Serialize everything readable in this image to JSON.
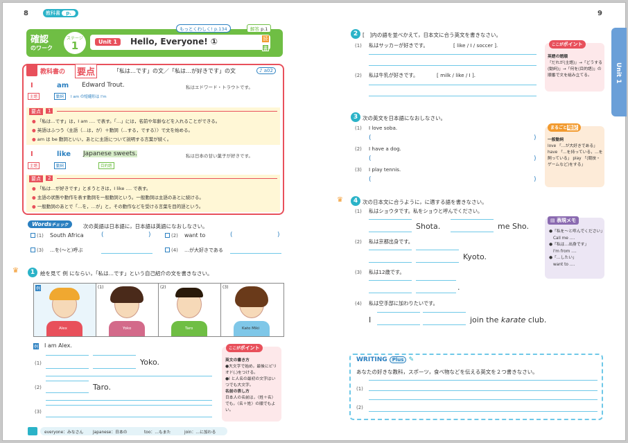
{
  "left_page": {
    "page_number": "8",
    "textbook_label": "教科書",
    "textbook_page": "p.",
    "header": {
      "kakunin": "確認",
      "no_work": "のワーク",
      "stage_label": "ステージ",
      "stage_num": "1",
      "unit_tag": "Unit 1",
      "unit_title": "Hello, Everyone! ①",
      "motto_label": "もっとくわしく!",
      "motto_page": "p.134",
      "answer_label": "解答",
      "answer_page": "p.1",
      "side_tabs": [
        "読",
        "書"
      ]
    },
    "point": {
      "title_a": "教科書の",
      "title_b": "要点",
      "subtitle": "「私は…です」の文／「私は…が好きです」の文",
      "audio": "a02",
      "ex1": {
        "w1": "I",
        "w2": "am",
        "w3": "Edward Trout.",
        "ja": "私はエドワード・トラウトです。",
        "tag1": "主語",
        "tag2": "動詞",
        "note": "I am の短縮形は I'm"
      },
      "p1": {
        "label": "要点",
        "num": "1",
        "lines": [
          "「私は…です」は，I am …. で表す。「…」には，名前や年齢などを入れることができる。",
          "英語はふつう〈主語（…は，が）＋動詞（…する，でする）〉で文を始める。",
          "am は be 動詞といい，あとに主語について説明する言葉が続く。"
        ]
      },
      "ex2": {
        "w1": "I",
        "w2": "like",
        "w3": "Japanese sweets.",
        "ja": "私は日本の甘い菓子が好きです。",
        "tag1": "主語",
        "tag2": "動詞",
        "tag3": "目的語"
      },
      "p2": {
        "label": "要点",
        "num": "2",
        "lines": [
          "「私は…が好きです」とまうときは，I like …. で表す。",
          "主語の状態や動作を表す動詞を一般動詞という。一般動詞は主語のあとに続ける。",
          "一般動詞のあとで「…を，…が」と，その動作などを受ける言葉を目的語という。"
        ]
      }
    },
    "words": {
      "logo": "Words",
      "logo2": "チェック",
      "instruction": "次の英語は日本語に，日本語は英語になおしなさい。",
      "items": [
        {
          "n": "(1)",
          "q": "South Africa",
          "a": "("
        },
        {
          "n": "(2)",
          "q": "want to",
          "a": "("
        },
        {
          "n": "(3)",
          "q": "…を(～と)呼ぶ",
          "a": ""
        },
        {
          "n": "(4)",
          "q": "…が大好きである",
          "a": ""
        }
      ]
    },
    "q1": {
      "num": "1",
      "instruction": "絵を見て 例 にならい，「私は…です」という自己紹介の文を書きなさい。",
      "pics": [
        {
          "tag": "例",
          "name": "Alex"
        },
        {
          "tag": "(1)",
          "name": "Yoko"
        },
        {
          "tag": "(2)",
          "name": "Taro"
        },
        {
          "tag": "(3)",
          "name": "Kato Miki"
        }
      ],
      "example": "I am Alex.",
      "a1_num": "(1)",
      "a1_word": "Yoko.",
      "a2_num": "(2)",
      "a2_word": "Taro.",
      "a3_num": "(3)"
    },
    "point_box": {
      "title_a": "ここが",
      "title_b": "ポイント",
      "h1": "英文の書き方",
      "l1": "●大文字で始め，最後にピリオド(.)をつける。",
      "l2": "●I と人名の最初の文字はいつでも大文字。",
      "h2": "名前の表し方",
      "l3": "日本人の名前は，〈姓＋名〉でも，〈名＋姓〉の順でもよい。"
    },
    "footer": [
      {
        "en": "everyone",
        "ja": "みなさん"
      },
      {
        "en": "Japanese",
        "ja": "日本の"
      },
      {
        "en": "too",
        "ja": "…もまた"
      },
      {
        "en": "join",
        "ja": "…に加わる"
      }
    ]
  },
  "right_page": {
    "page_number": "9",
    "unit_tab": "Unit 1",
    "q2": {
      "num": "2",
      "instruction": "[　]内の語を並べかえて，日本文に合う英文を書きなさい。",
      "i1": {
        "n": "(1)",
        "ja": "私はサッカーが好きです。",
        "words": "[ like / I / soccer ]."
      },
      "i2": {
        "n": "(2)",
        "ja": "私は牛乳が好きです。",
        "words": "[ milk / like / I ]."
      }
    },
    "kokoga": {
      "title_a": "ここが",
      "title_b": "ポイント",
      "head": "英語の語順",
      "body": "「だれが(主語)」→「どうする(動詞)」→「何を(目的語)」の順番で文を組み立てる。"
    },
    "q3": {
      "num": "3",
      "instruction": "次の英文を日本語になおしなさい。",
      "items": [
        {
          "n": "(1)",
          "en": "I love soba."
        },
        {
          "n": "(2)",
          "en": "I have a dog."
        },
        {
          "n": "(3)",
          "en": "I play tennis."
        }
      ]
    },
    "marugoto": {
      "title_a": "まるごと",
      "title_b": "暗記",
      "head": "一般動詞",
      "body": "love 「…が大好きである」 have 「…を持っている，…を飼っている」 play 「(競技・ゲームなど)をする」"
    },
    "q4": {
      "num": "4",
      "instruction": "次の日本文に合うように，に適する語を書きなさい。",
      "i1": {
        "n": "(1)",
        "ja": "私はショウタです。私をショウと呼んでください。",
        "w1": "Shota.",
        "w2": "me Sho."
      },
      "i2": {
        "n": "(2)",
        "ja": "私は京都出身です。",
        "w1": "Kyoto."
      },
      "i3": {
        "n": "(3)",
        "ja": "私は12歳です。",
        "w1": "."
      },
      "i4": {
        "n": "(4)",
        "ja": "私は空手部に加わりたいです。",
        "w0": "I",
        "w1": "join the",
        "w2": "karate",
        "w3": "club."
      }
    },
    "hyogen": {
      "title": "表現メモ",
      "lines": [
        "●「私を～と呼んでください」",
        "Call me ….",
        "●「私は…出身です」",
        "I'm from ….",
        "●「…したい」",
        "want to …."
      ]
    },
    "writing": {
      "logo": "WRITING",
      "plus": "Plus",
      "instruction": "あなたの好きな教科，スポーツ，食べ物などを伝える英文を２つ書きなさい。",
      "n1": "(1)",
      "n2": "(2)"
    }
  },
  "colors": {
    "pink": "#e8505b",
    "blue": "#2a7fc0",
    "green": "#6fbe44",
    "cyan": "#2bb3c8",
    "yellow": "#fff7d6",
    "orange": "#f29a2e"
  }
}
